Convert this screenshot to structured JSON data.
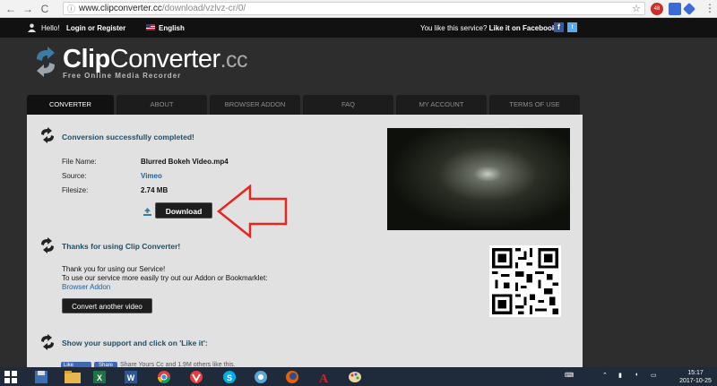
{
  "browser": {
    "url_host": "www.clipconverter.cc",
    "url_path": "/download/vzlvz-cr/0/",
    "nav_back": "←",
    "nav_forward": "→",
    "nav_reload": "C",
    "star": "☆",
    "ext_badge": "48",
    "menu": "⋮"
  },
  "topbar": {
    "hello": "Hello!",
    "login": "Login or Register",
    "language": "English",
    "like_prefix": "You like this service?",
    "like_cta": "Like it on Facebook!",
    "fb": "f",
    "tw": "t"
  },
  "logo": {
    "clip": "Clip",
    "converter": "Converter",
    "tld": ".cc",
    "tagline": "Free Online Media Recorder"
  },
  "tabs": [
    {
      "label": "CONVERTER",
      "active": true
    },
    {
      "label": "ABOUT",
      "active": false
    },
    {
      "label": "BROWSER ADDON",
      "active": false
    },
    {
      "label": "FAQ",
      "active": false
    },
    {
      "label": "MY ACCOUNT",
      "active": false
    },
    {
      "label": "TERMS OF USE",
      "active": false
    }
  ],
  "conversion": {
    "title": "Conversion successfully completed!",
    "file_name_label": "File Name:",
    "file_name": "Blurred Bokeh Video.mp4",
    "source_label": "Source:",
    "source": "Vimeo",
    "filesize_label": "Filesize:",
    "filesize": "2.74 MB",
    "download_label": "Download"
  },
  "thanks": {
    "title": "Thanks for using Clip Converter!",
    "line1": "Thank you for using our Service!",
    "line2": "To use our service more easily try out our Addon or Bookmarklet:",
    "addon_link": "Browser Addon",
    "convert_another": "Convert another video"
  },
  "support": {
    "title": "Show your support and click on 'Like it':",
    "like": "Like",
    "share": "Share",
    "info": "Share Yours Cc and 1.9M others like this."
  },
  "taskbar": {
    "time": "15:17",
    "date": "2017-10-25",
    "apps": [
      "file-explorer",
      "excel",
      "word",
      "chrome",
      "vivaldi",
      "skype",
      "chrome-2",
      "firefox",
      "acrobat",
      "paint"
    ]
  }
}
